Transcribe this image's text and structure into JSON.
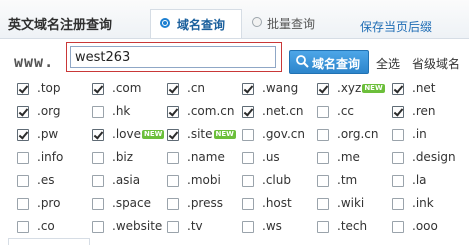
{
  "header": {
    "title": "英文域名注册查询",
    "tabs": [
      {
        "label": "域名查询",
        "active": true
      },
      {
        "label": "批量查询",
        "active": false
      }
    ],
    "save_link": "保存当页后缀"
  },
  "search": {
    "prefix": "www.",
    "value": "west263",
    "button_label": "域名查询",
    "select_all": "全选",
    "tld_link": "省级域名"
  },
  "colors": {
    "accent": "#1c7fd1",
    "button": "#2d85cb",
    "new_badge": "#6cbf3b",
    "input_highlight": "#c93838"
  },
  "tld_grid": [
    [
      {
        "label": ".top",
        "checked": true
      },
      {
        "label": ".com",
        "checked": true
      },
      {
        "label": ".cn",
        "checked": true
      },
      {
        "label": ".wang",
        "checked": true
      },
      {
        "label": ".xyz",
        "checked": true,
        "badge": "NEW"
      },
      {
        "label": ".net",
        "checked": true
      }
    ],
    [
      {
        "label": ".org",
        "checked": true
      },
      {
        "label": ".hk",
        "checked": false
      },
      {
        "label": ".com.cn",
        "checked": true
      },
      {
        "label": ".net.cn",
        "checked": true
      },
      {
        "label": ".cc",
        "checked": false
      },
      {
        "label": ".ren",
        "checked": true
      }
    ],
    [
      {
        "label": ".pw",
        "checked": true
      },
      {
        "label": ".love",
        "checked": true,
        "badge": "NEW"
      },
      {
        "label": ".site",
        "checked": true,
        "badge": "NEW"
      },
      {
        "label": ".gov.cn",
        "checked": false
      },
      {
        "label": ".org.cn",
        "checked": false
      },
      {
        "label": ".in",
        "checked": false
      }
    ],
    [
      {
        "label": ".info",
        "checked": false
      },
      {
        "label": ".biz",
        "checked": false
      },
      {
        "label": ".name",
        "checked": false
      },
      {
        "label": ".us",
        "checked": false
      },
      {
        "label": ".me",
        "checked": false
      },
      {
        "label": ".design",
        "checked": false
      }
    ],
    [
      {
        "label": ".es",
        "checked": false
      },
      {
        "label": ".asia",
        "checked": false
      },
      {
        "label": ".mobi",
        "checked": false
      },
      {
        "label": ".club",
        "checked": false
      },
      {
        "label": ".tm",
        "checked": false
      },
      {
        "label": ".la",
        "checked": false
      }
    ],
    [
      {
        "label": ".pro",
        "checked": false
      },
      {
        "label": ".space",
        "checked": false
      },
      {
        "label": ".press",
        "checked": false
      },
      {
        "label": ".host",
        "checked": false
      },
      {
        "label": ".wiki",
        "checked": false
      },
      {
        "label": ".ink",
        "checked": false
      }
    ],
    [
      {
        "label": ".co",
        "checked": false
      },
      {
        "label": ".website",
        "checked": false
      },
      {
        "label": ".tv",
        "checked": false
      },
      {
        "label": ".ws",
        "checked": false
      },
      {
        "label": ".tech",
        "checked": false
      },
      {
        "label": ".ooo",
        "checked": false
      }
    ]
  ]
}
